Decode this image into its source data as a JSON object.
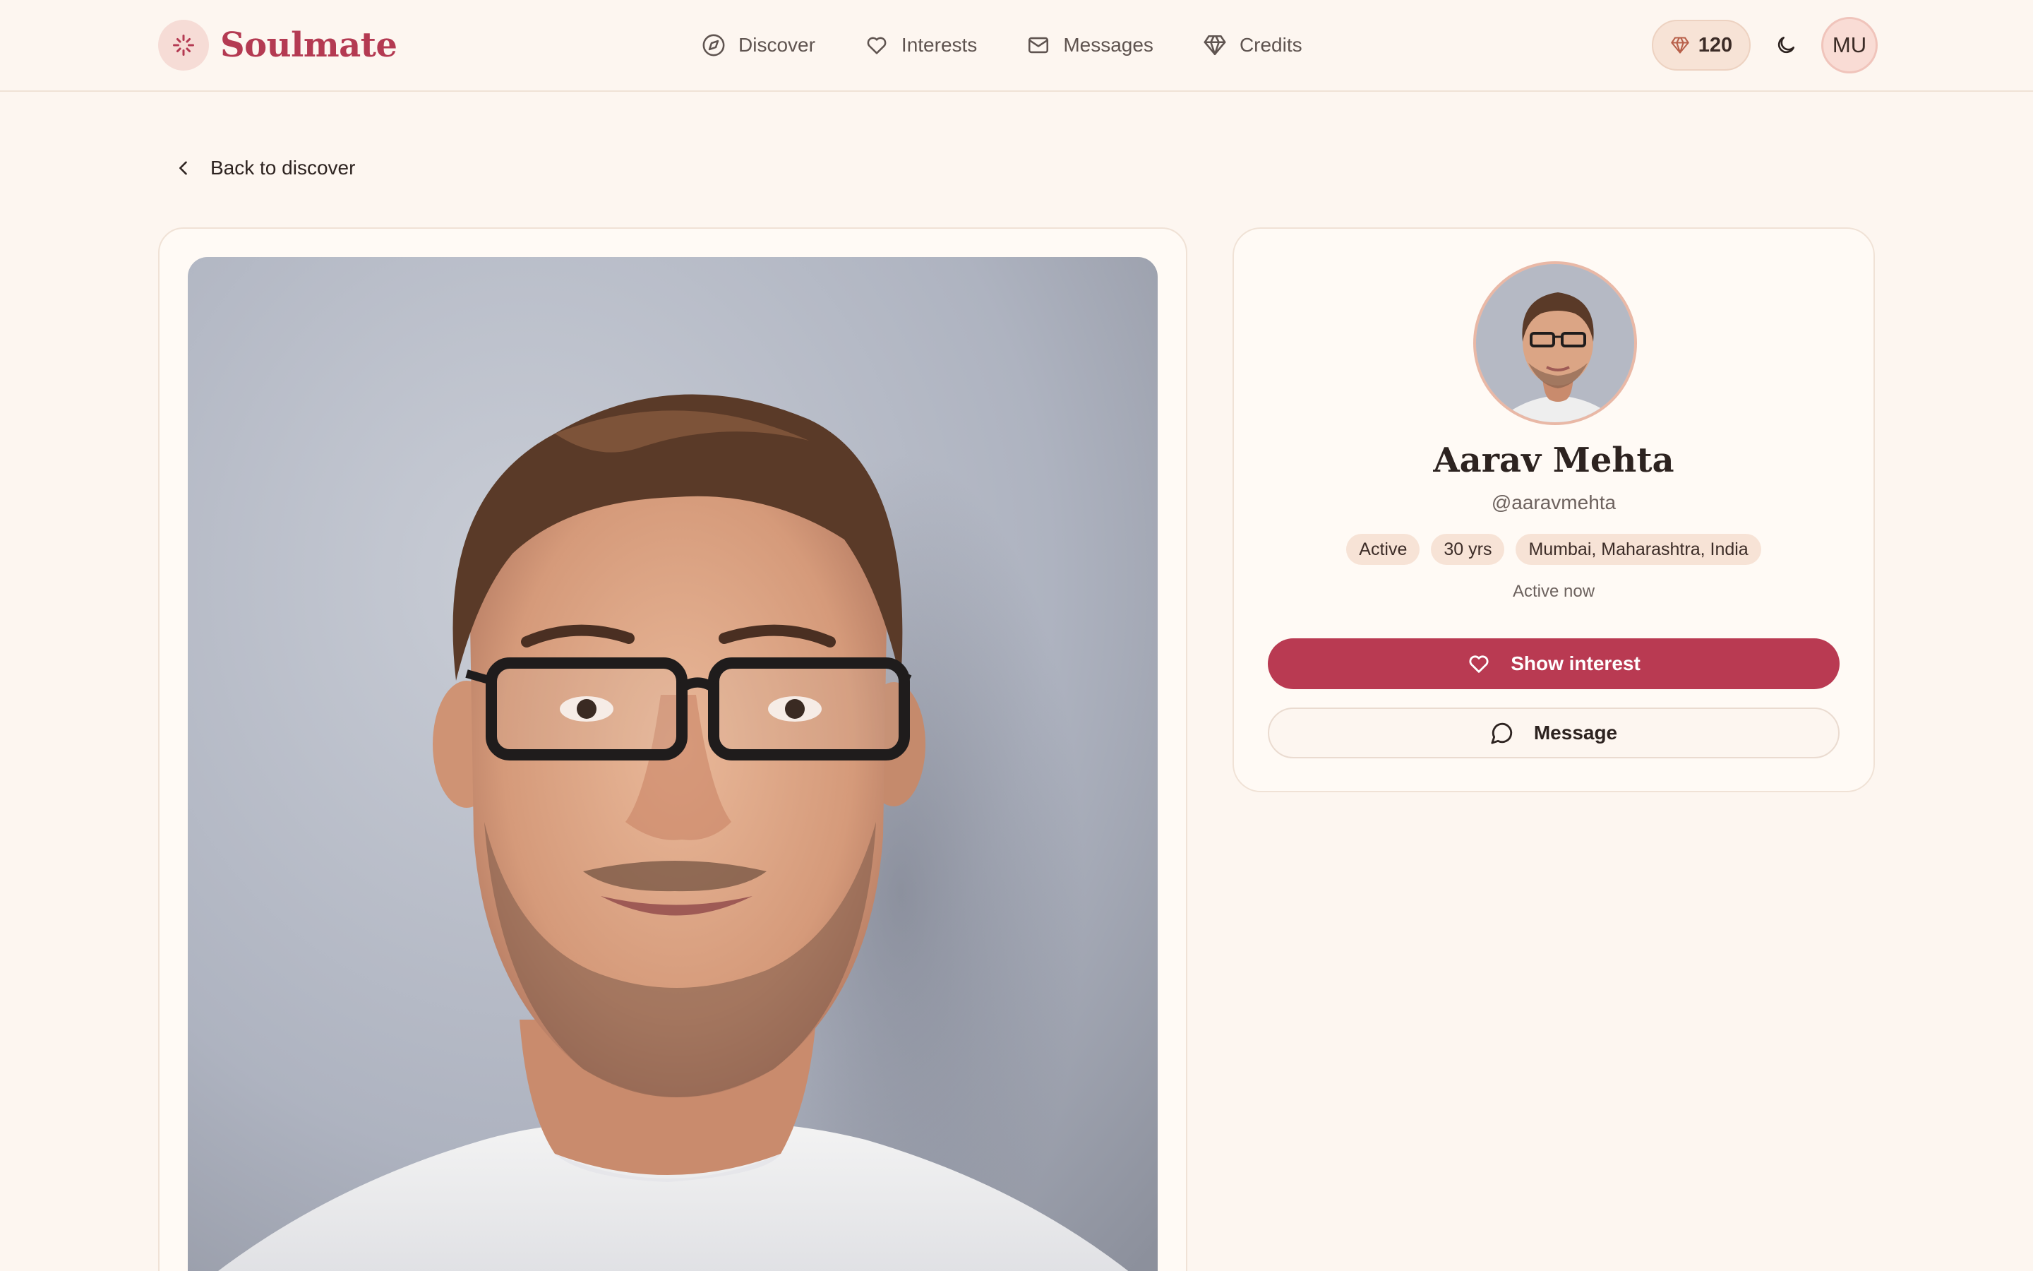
{
  "brand": {
    "name": "Soulmate",
    "accent": "#b93a52"
  },
  "nav": {
    "items": [
      {
        "label": "Discover",
        "icon": "compass-icon"
      },
      {
        "label": "Interests",
        "icon": "heart-icon"
      },
      {
        "label": "Messages",
        "icon": "mail-icon"
      },
      {
        "label": "Credits",
        "icon": "gem-icon"
      }
    ]
  },
  "header": {
    "credits": "120",
    "credits_icon": "gem-icon",
    "theme_icon": "moon-icon",
    "user_initials": "MU"
  },
  "back": {
    "label": "Back to discover",
    "icon": "chevron-left-icon"
  },
  "profile": {
    "name": "Aarav Mehta",
    "handle": "@aaravmehta",
    "tags": [
      "Active",
      "30 yrs",
      "Mumbai, Maharashtra, India"
    ],
    "status": "Active now",
    "primary_action": {
      "label": "Show interest",
      "icon": "heart-icon"
    },
    "secondary_action": {
      "label": "Message",
      "icon": "chat-bubble-icon"
    }
  }
}
